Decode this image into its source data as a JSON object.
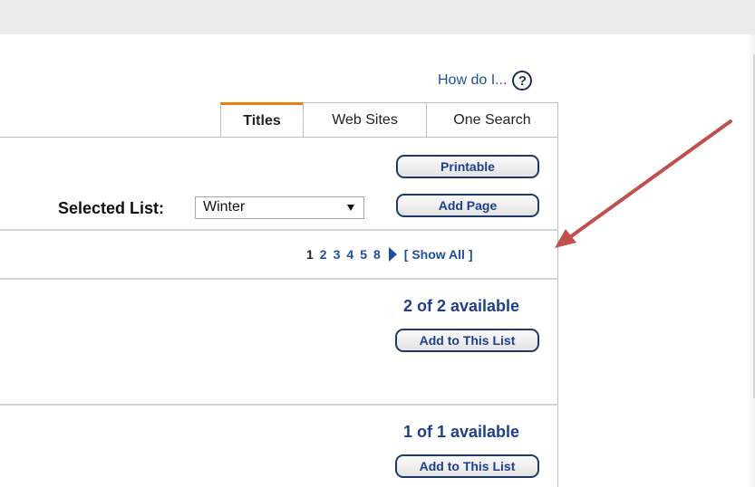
{
  "help": {
    "label": "How do I...",
    "icon": "?"
  },
  "tabs": [
    {
      "label": "Titles",
      "active": true
    },
    {
      "label": "Web Sites",
      "active": false
    },
    {
      "label": "One Search",
      "active": false
    }
  ],
  "toolbar": {
    "printable_label": "Printable",
    "add_page_label": "Add Page"
  },
  "selected_list": {
    "label": "Selected List:",
    "value": "Winter"
  },
  "pager": {
    "pages": [
      "1",
      "2",
      "3",
      "4",
      "5",
      "8"
    ],
    "current": "1",
    "show_all": "[ Show All ]"
  },
  "results": [
    {
      "availability": "2 of 2 available",
      "button": "Add to This List"
    },
    {
      "availability": "1 of 1 available",
      "button": "Add to This List"
    }
  ],
  "colors": {
    "link": "#1f4e9e",
    "tab_accent": "#e87e10",
    "annotation_arrow": "#c0504d"
  }
}
